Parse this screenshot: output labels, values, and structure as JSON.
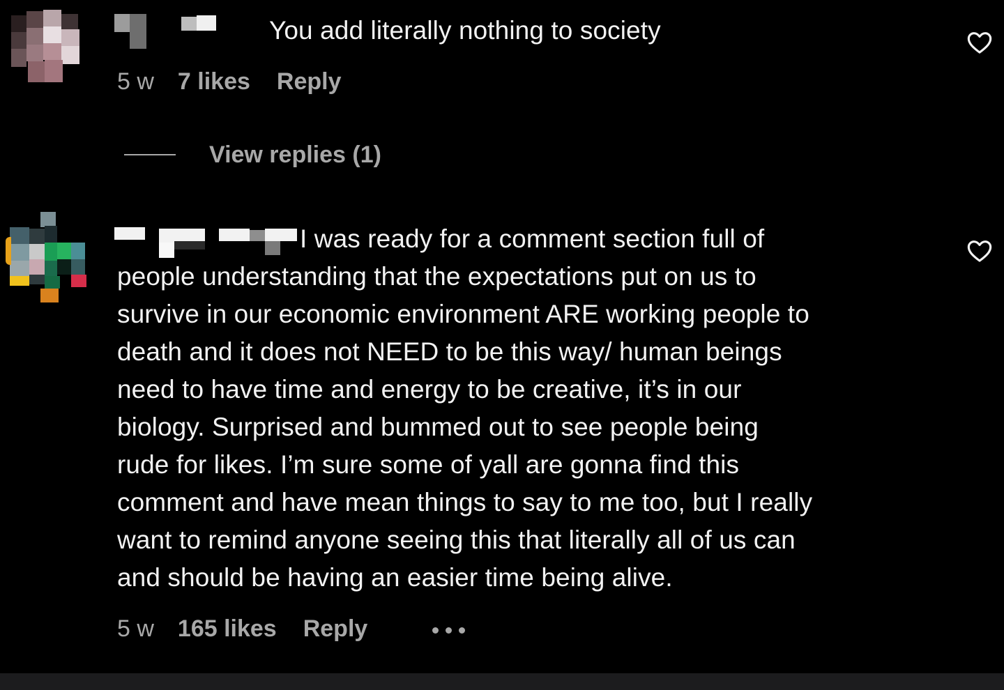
{
  "comments": [
    {
      "text": "You add literally nothing to society",
      "age": "5 w",
      "likes": "7 likes",
      "reply_label": "Reply"
    },
    {
      "lines": [
        "I was ready for a comment section full of",
        "people understanding that the expectations put on us to",
        "survive in our economic environment ARE working people to",
        "death and it does not NEED to be this way/ human beings",
        "need to have time and energy to be creative, it’s in our",
        "biology. Surprised and bummed out to see people being",
        "rude for likes. I’m sure some of yall are gonna find this",
        "comment and have mean things to say to me too, but I really",
        "want to remind anyone seeing this that literally all of us can",
        "and should be having an easier time being alive."
      ],
      "age": "5 w",
      "likes": "165 likes",
      "reply_label": "Reply",
      "more_icon": "ellipsis-icon"
    }
  ],
  "view_replies": "View replies (1)",
  "icons": {
    "like": "heart-outline-icon",
    "avatar": "pixelated-avatar"
  },
  "colors": {
    "background": "#000000",
    "text": "#f2f2f2",
    "meta": "#a8a8a8"
  }
}
